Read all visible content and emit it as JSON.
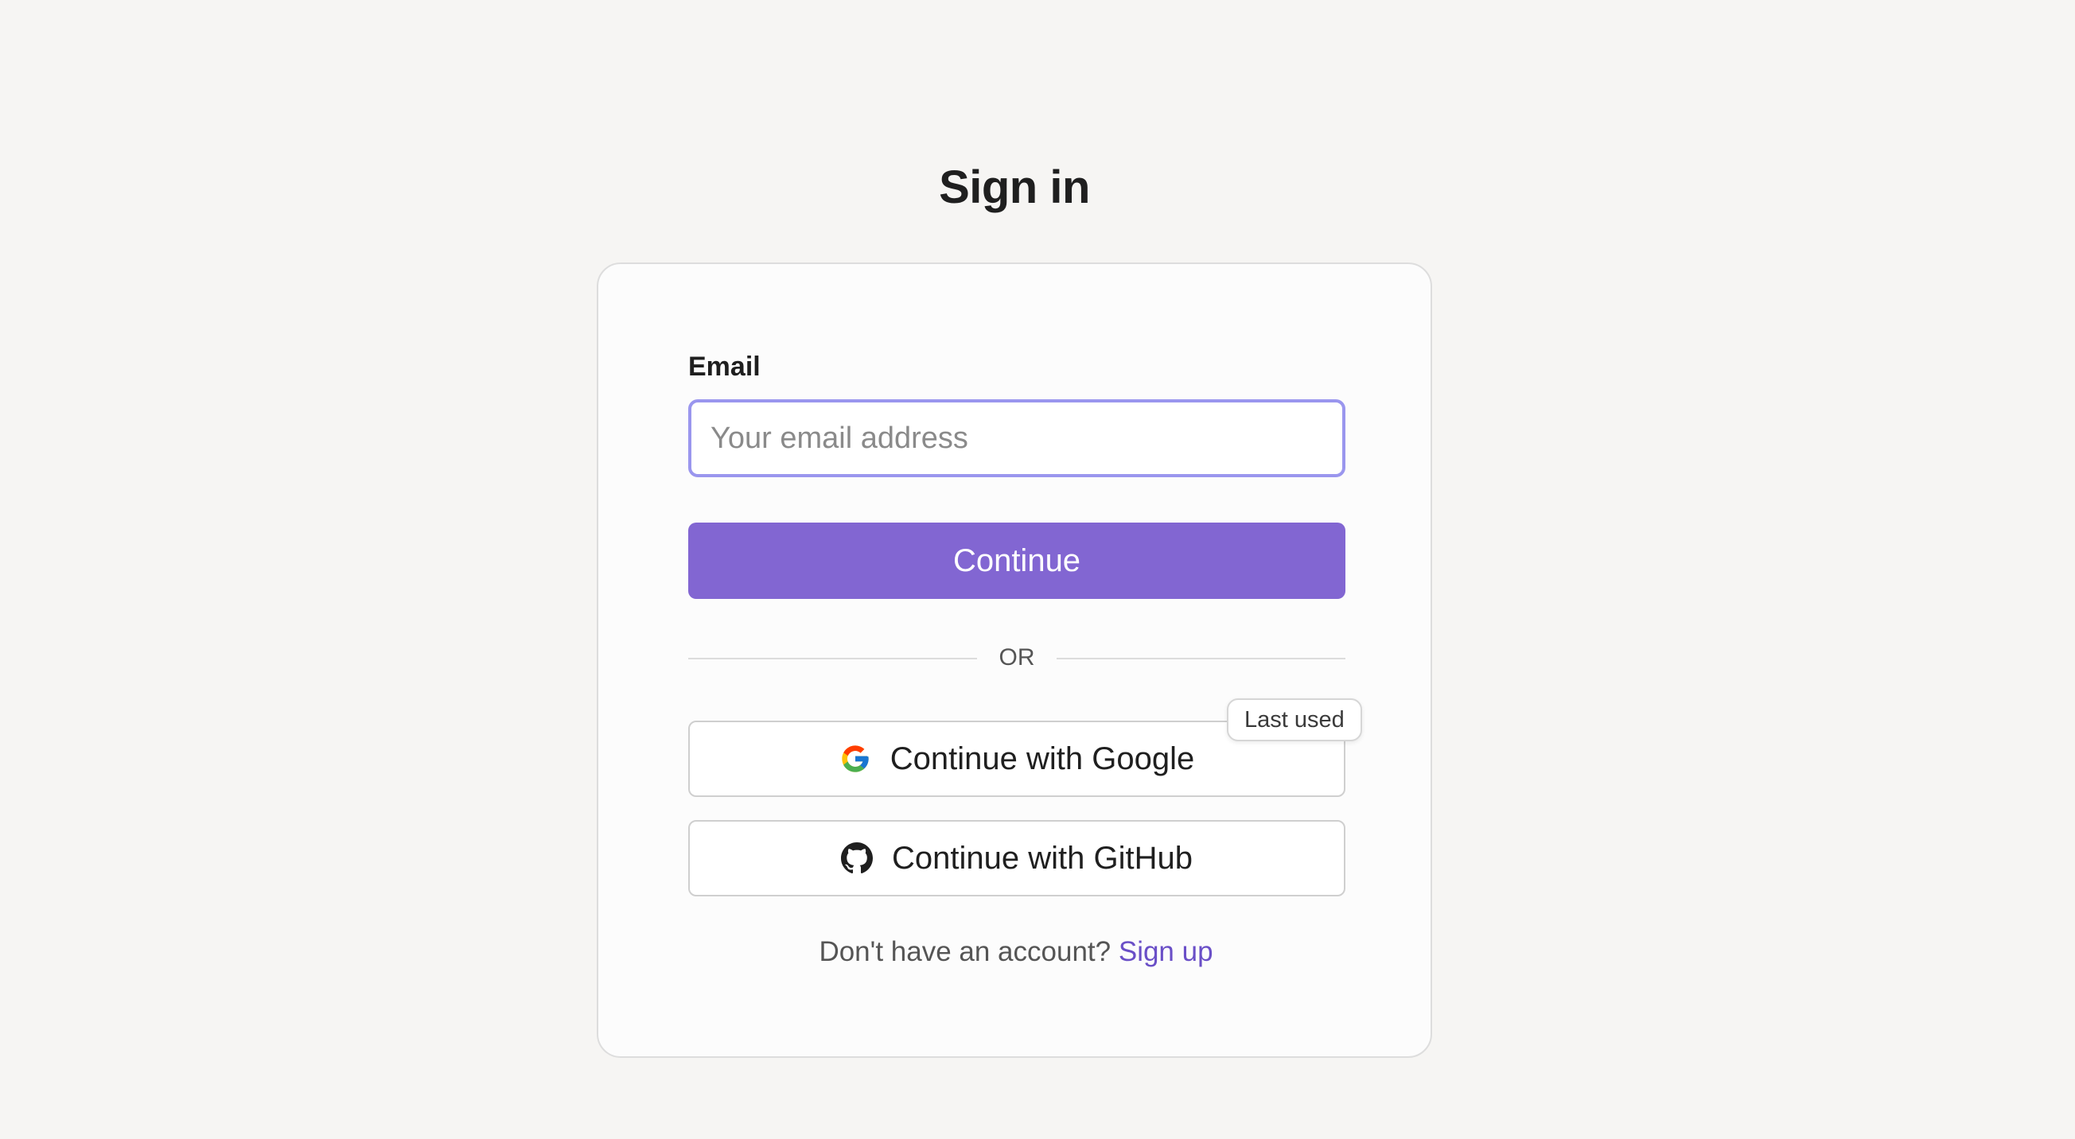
{
  "page": {
    "title": "Sign in"
  },
  "form": {
    "email_label": "Email",
    "email_placeholder": "Your email address",
    "email_value": "",
    "continue_label": "Continue",
    "divider_text": "OR"
  },
  "oauth": {
    "google_label": "Continue with Google",
    "google_icon": "google-icon",
    "github_label": "Continue with GitHub",
    "github_icon": "github-icon",
    "last_used_badge": "Last used"
  },
  "footer": {
    "prompt": "Don't have an account?",
    "signup_link": "Sign up"
  },
  "colors": {
    "background": "#f6f5f3",
    "accent": "#8266d2",
    "link": "#6a4fc7",
    "input_focus_border": "#9a96ee"
  }
}
